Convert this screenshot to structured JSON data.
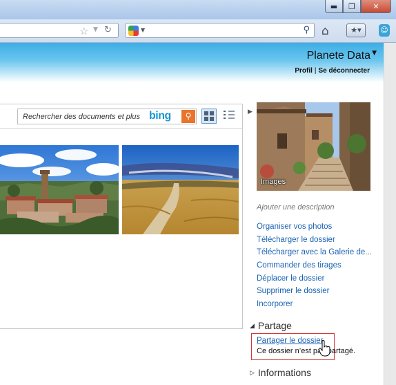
{
  "window": {
    "minimize_glyph": "▬",
    "maximize_glyph": "❐",
    "close_glyph": "✕"
  },
  "browser": {
    "search_engine_icon": "google-icon",
    "home_icon": "⌂",
    "bookmarks_icon": "★▾",
    "addon_icon": "☺"
  },
  "header": {
    "brand": "Planete Data",
    "profile_link": "Profil",
    "separator": "|",
    "logout_link": "Se déconnecter",
    "accent_color": "#3caee6"
  },
  "main": {
    "search_placeholder": "Rechercher des documents et plus",
    "search_brand": "bing",
    "photos": [
      {
        "subject": "tuscan-village-photo"
      },
      {
        "subject": "wheat-field-road-photo"
      }
    ]
  },
  "sidebar": {
    "thumbnail_label": "Images",
    "add_description": "Ajouter une description",
    "actions": [
      "Organiser vos photos",
      "Télécharger le dossier",
      "Télécharger avec la Galerie de...",
      "Commander des tirages",
      "Déplacer le dossier",
      "Supprimer le dossier",
      "Incorporer"
    ],
    "sharing": {
      "title": "Partage",
      "share_link": "Partager le dossier",
      "status": "Ce dossier n’est pas partagé."
    },
    "info": {
      "title": "Informations"
    },
    "link_color": "#1a64b3"
  }
}
